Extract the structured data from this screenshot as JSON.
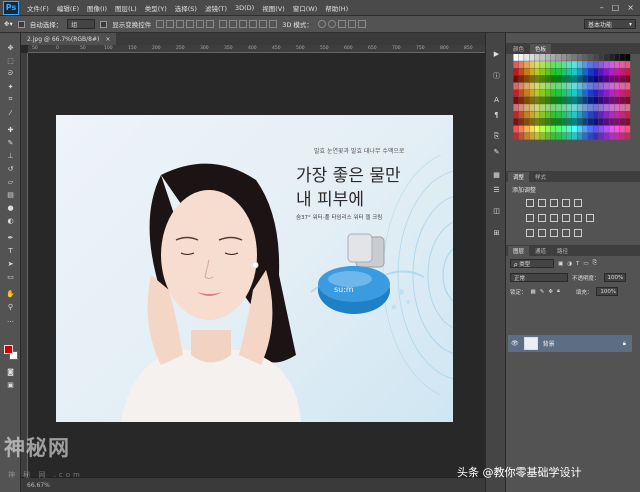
{
  "app": {
    "logo": "Ps"
  },
  "menu": [
    "文件(F)",
    "编辑(E)",
    "图像(I)",
    "图层(L)",
    "类型(Y)",
    "选择(S)",
    "滤镜(T)",
    "3D(D)",
    "视图(V)",
    "窗口(W)",
    "帮助(H)"
  ],
  "options": {
    "auto_select_label": "自动选择：",
    "auto_select_value": "组",
    "transform_label": "显示变换控件",
    "mode3d_label": "3D 模式：",
    "workspace": "基本功能"
  },
  "document": {
    "tab_label": "2.jpg @ 66.7%(RGB/8#)",
    "close_glyph": "×",
    "ruler_ticks": [
      "50",
      "0",
      "50",
      "100",
      "150",
      "200",
      "250",
      "300",
      "350",
      "400",
      "450",
      "500",
      "550",
      "600",
      "650",
      "700",
      "750",
      "800",
      "850"
    ]
  },
  "image_text": {
    "sub": "발효 눈연꽃과 발효 대나무 수액으로",
    "headline_1": "가장 좋은 물만",
    "headline_2": "내 피부에",
    "product_line": "숨37° 워터-풀 타임리스 워터 젤 크림",
    "product_brand": "su:m"
  },
  "status": {
    "zoom": "66.67%"
  },
  "panels": {
    "color_tabs": [
      "颜色",
      "色板"
    ],
    "adjust_tabs": [
      "调整",
      "样式"
    ],
    "adjust_title": "添加调整",
    "layers_tabs": [
      "图层",
      "通道",
      "路径"
    ],
    "kind_label": "ρ 类型",
    "blend_mode": "正常",
    "opacity_label": "不透明度：",
    "opacity_value": "100%",
    "lock_label": "锁定：",
    "fill_label": "填充：",
    "fill_value": "100%",
    "layer_name": "背景"
  },
  "watermarks": {
    "left": "神秘网",
    "left_sub": "神 秘 网 .com",
    "right": "头条 @教你零基础学设计"
  },
  "colors": {
    "accent": "#3fa9f5",
    "foreground": "#d10000",
    "background": "#ffffff",
    "layer_selected": "#5d6e84"
  }
}
